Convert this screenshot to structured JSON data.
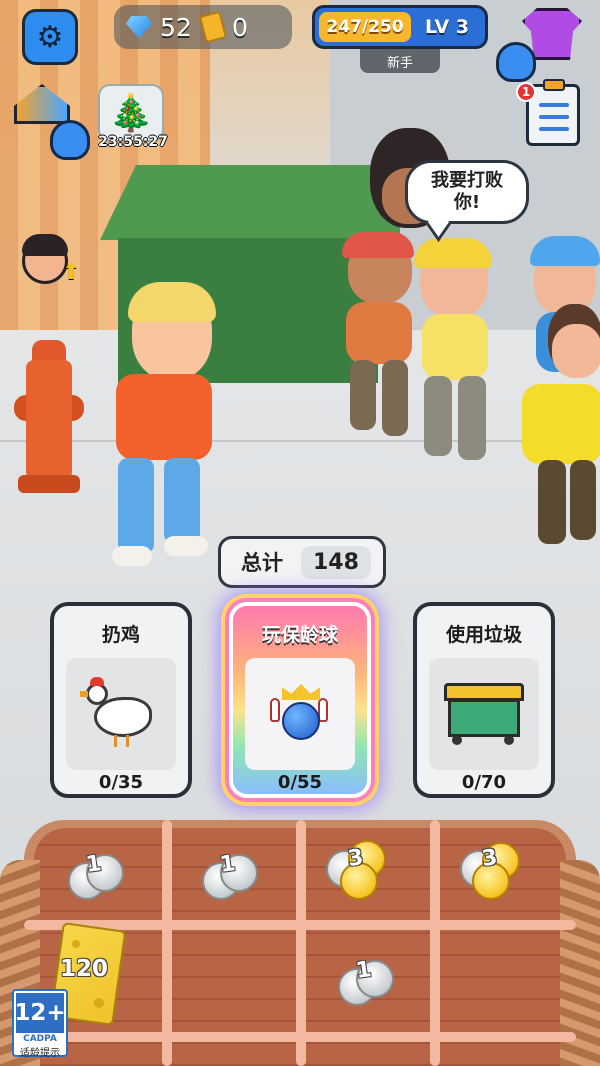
{
  "hud": {
    "gems": "52",
    "tickets": "0",
    "exp": "247/250",
    "level": "LV 3",
    "rank": "新手",
    "event_timer": "23:55:27",
    "task_badge": "1"
  },
  "speech_bubble": [
    "我要打败",
    "你!"
  ],
  "total": {
    "label": "总计",
    "value": "148"
  },
  "cards": [
    {
      "title": "扔鸡",
      "progress": "0/35",
      "icon": "chicken-icon",
      "active": false
    },
    {
      "title": "玩保龄球",
      "progress": "0/55",
      "icon": "bowling-icon",
      "active": true
    },
    {
      "title": "使用垃圾",
      "progress": "0/70",
      "icon": "dumpster-icon",
      "active": false
    }
  ],
  "crate": {
    "coins": [
      {
        "value": "1",
        "kind": "silver"
      },
      {
        "value": "1",
        "kind": "silver"
      },
      {
        "value": "3",
        "kind": "gold"
      },
      {
        "value": "3",
        "kind": "gold"
      },
      {
        "value": "1",
        "kind": "silver"
      }
    ],
    "cash": "120"
  },
  "age_rating": {
    "age": "12+",
    "org": "CADPA",
    "tip": "适龄提示"
  },
  "colors": {
    "hud_blue": "#2b6fd6",
    "exp_gold": "#f6b72c",
    "dumpster_green": "#3a7f3f",
    "hydrant_orange": "#e8622f",
    "card_active_glow": "#ff7fb8"
  }
}
